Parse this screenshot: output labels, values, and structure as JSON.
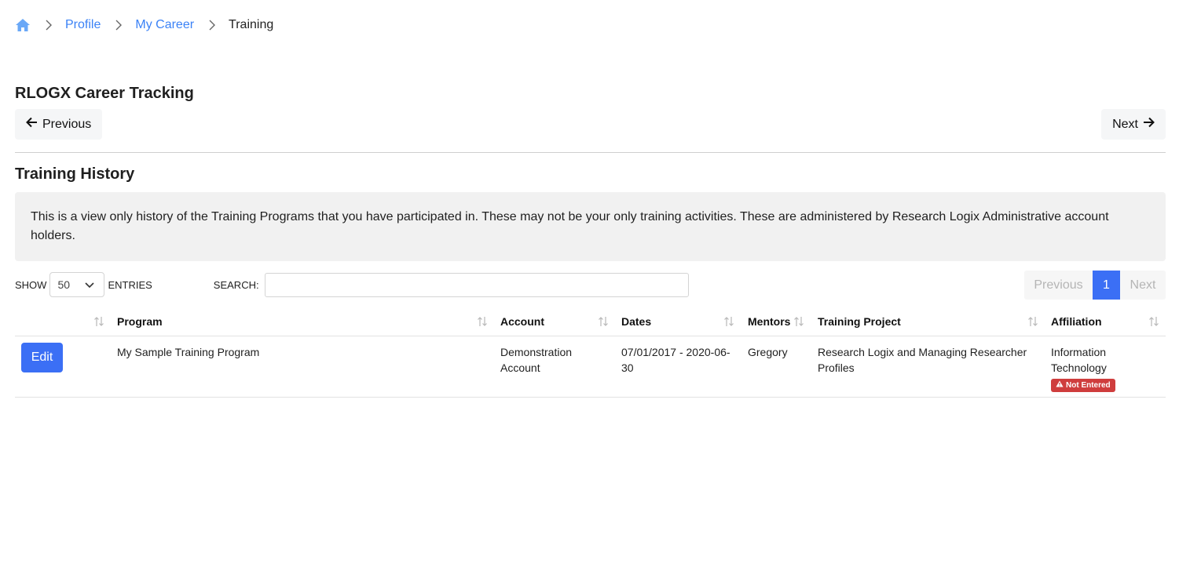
{
  "breadcrumb": {
    "home_icon": "home-icon",
    "items": [
      {
        "label": "Profile"
      },
      {
        "label": "My Career"
      }
    ],
    "current": "Training"
  },
  "page": {
    "title": "RLOGX Career Tracking",
    "previous_label": "Previous",
    "next_label": "Next"
  },
  "section": {
    "title": "Training History",
    "info": "This is a view only history of the Training Programs that you have participated in. These may not be your only training activities. These are administered by Research Logix Administrative account holders."
  },
  "table_controls": {
    "show_label": "SHOW",
    "entries_value": "50",
    "entries_label": "ENTRIES",
    "search_label": "SEARCH:",
    "search_value": "",
    "pager": {
      "previous": "Previous",
      "current_page": "1",
      "next": "Next"
    }
  },
  "table": {
    "columns": [
      "",
      "Program",
      "Account",
      "Dates",
      "Mentors",
      "Training Project",
      "Affiliation"
    ],
    "rows": [
      {
        "action": "Edit",
        "program": "My Sample Training Program",
        "account": "Demonstration Account",
        "dates": "07/01/2017 - 2020-06-30",
        "mentors": "Gregory",
        "project": "Research Logix and Managing Researcher Profiles",
        "affiliation": "Information Technology",
        "badge": "Not Entered"
      }
    ]
  },
  "colors": {
    "accent": "#3b6ff5",
    "link": "#3b82f6",
    "badge": "#cf3d3d"
  }
}
